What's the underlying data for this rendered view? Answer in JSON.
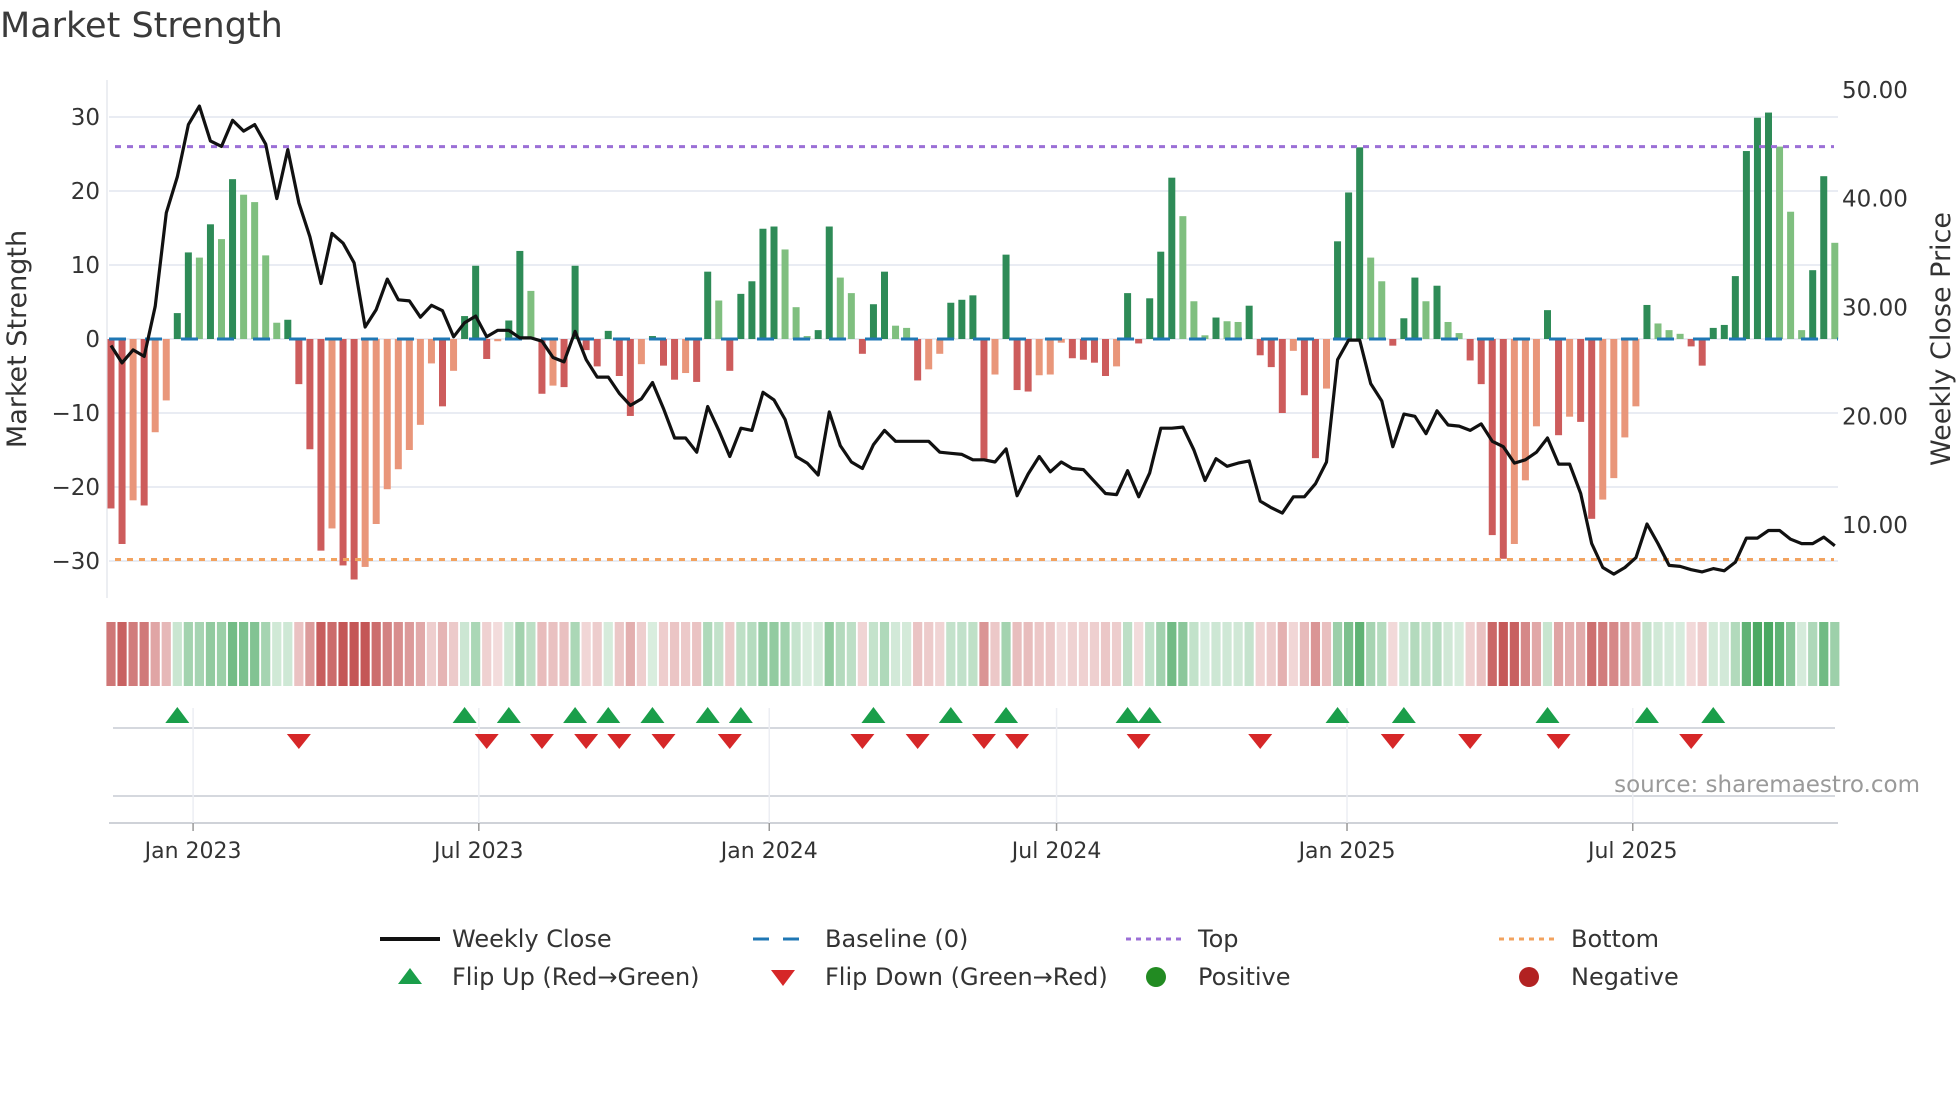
{
  "title": "Market Strength",
  "source": "source: sharemaestro.com",
  "colors": {
    "bar_pos_strong": "#2e8b57",
    "bar_pos_weak": "#7fbf7f",
    "bar_neg_strong": "#cd5c5c",
    "bar_neg_weak": "#e9967a",
    "baseline": "#1f77b4",
    "top": "#9b6fd6",
    "bottom": "#f2a25e",
    "flip_up": "#1a9e4a",
    "flip_down": "#d62728",
    "positive": "#228b22",
    "negative": "#b22222",
    "heat_pos": "#4aa862",
    "heat_neg": "#c45656",
    "grid": "#e9ecf3",
    "price": "#111111"
  },
  "legend": {
    "weekly_close": "Weekly Close",
    "baseline": "Baseline (0)",
    "top": "Top",
    "bottom": "Bottom",
    "flip_up": "Flip Up (Red→Green)",
    "flip_down": "Flip Down (Green→Red)",
    "positive": "Positive",
    "negative": "Negative"
  },
  "chart_data": {
    "type": "bar",
    "title": "Market Strength",
    "ylabel": "Market Strength",
    "y2label": "Weekly Close Price",
    "ylim": [
      -35,
      35
    ],
    "y2lim": [
      3.3,
      50.9
    ],
    "yticks": [
      -30,
      -20,
      -10,
      0,
      10,
      20,
      30
    ],
    "ytick_labels": [
      "−30",
      "−20",
      "−10",
      "0",
      "10",
      "20",
      "30"
    ],
    "y2ticks": [
      10,
      20,
      30,
      40,
      50
    ],
    "y2tick_labels": [
      "10.00",
      "20.00",
      "30.00",
      "40.00",
      "50.00"
    ],
    "x_start": "2022-11-10",
    "x_step_days": 7,
    "xticks": [
      "2023-01-01",
      "2023-07-01",
      "2024-01-01",
      "2024-07-01",
      "2025-01-01",
      "2025-07-01"
    ],
    "xtick_labels": [
      "Jan 2023",
      "Jul 2023",
      "Jan 2024",
      "Jul 2024",
      "Jan 2025",
      "Jul 2025"
    ],
    "top_level": 26.0,
    "bottom_level": -29.8,
    "baseline": 0,
    "strength": [
      -22.9,
      -27.7,
      -21.8,
      -22.5,
      -12.6,
      -8.3,
      3.5,
      11.7,
      11,
      15.5,
      13.5,
      21.6,
      19.5,
      18.5,
      11.3,
      2.2,
      2.6,
      -6.1,
      -14.9,
      -28.6,
      -25.6,
      -30.6,
      -32.5,
      -30.8,
      -25,
      -20.3,
      -17.6,
      -15,
      -11.6,
      -3.3,
      -9.1,
      -4.3,
      3.1,
      9.9,
      -2.7,
      -0.3,
      2.5,
      11.9,
      6.5,
      -7.4,
      -6.3,
      -6.5,
      9.9,
      -1.5,
      -3.7,
      1.1,
      -5,
      -10.4,
      -3.4,
      0.4,
      -3.6,
      -5.5,
      -4.6,
      -5.8,
      9.1,
      5.2,
      -4.3,
      6.1,
      7.8,
      14.9,
      15.2,
      12.1,
      4.3,
      0.4,
      1.2,
      15.2,
      8.3,
      6.2,
      -2,
      4.7,
      9.1,
      1.8,
      1.5,
      -5.6,
      -4.1,
      -2,
      4.9,
      5.3,
      5.9,
      -16.2,
      -4.8,
      11.4,
      -6.9,
      -7.1,
      -4.9,
      -4.8,
      -0.5,
      -2.6,
      -2.8,
      -3.2,
      -5,
      -3.7,
      6.2,
      -0.6,
      5.5,
      11.8,
      21.8,
      16.6,
      5.1,
      0.5,
      2.9,
      2.4,
      2.3,
      4.5,
      -2.2,
      -3.8,
      -10,
      -1.6,
      -7.6,
      -16.1,
      -6.7,
      13.2,
      19.8,
      25.9,
      11,
      7.8,
      -0.9,
      2.8,
      8.3,
      5.1,
      7.2,
      2.3,
      0.8,
      -2.9,
      -6.1,
      -26.5,
      -29.7,
      -27.7,
      -19.1,
      -11.8,
      3.9,
      -13,
      -10.5,
      -11.2,
      -24.3,
      -21.7,
      -18.8,
      -13.3,
      -9.1,
      4.6,
      2.1,
      1.2,
      0.7,
      -1,
      -3.6,
      1.5,
      1.9,
      8.5,
      25.4,
      29.9,
      30.6,
      26,
      17.2,
      1.2,
      9.3,
      22,
      13
    ],
    "weekly_close": [
      26.5,
      24.9,
      26.1,
      25.5,
      30.1,
      38.7,
      42,
      46.8,
      48.5,
      45.3,
      44.8,
      47.2,
      46.2,
      46.8,
      45,
      40,
      44.5,
      39.6,
      36.5,
      32.2,
      36.8,
      35.9,
      34.1,
      28.2,
      29.8,
      32.6,
      30.7,
      30.6,
      29.1,
      30.2,
      29.7,
      27.3,
      28.6,
      29.2,
      27.3,
      27.9,
      27.9,
      27.2,
      27.2,
      26.9,
      25.4,
      25,
      27.8,
      25.2,
      23.6,
      23.6,
      22.1,
      21,
      21.6,
      23.1,
      20.7,
      18,
      18,
      16.7,
      20.9,
      18.7,
      16.3,
      18.9,
      18.7,
      22.2,
      21.5,
      19.7,
      16.3,
      15.7,
      14.6,
      20.4,
      17.3,
      15.8,
      15.2,
      17.4,
      18.7,
      17.7,
      17.7,
      17.7,
      17.7,
      16.7,
      16.6,
      16.5,
      16,
      16,
      15.8,
      17,
      12.7,
      14.7,
      16.3,
      14.9,
      15.8,
      15.2,
      15.1,
      14,
      12.9,
      12.8,
      15,
      12.6,
      14.8,
      18.9,
      18.9,
      19,
      16.9,
      14.1,
      16.1,
      15.4,
      15.7,
      15.9,
      12.2,
      11.6,
      11.1,
      12.6,
      12.6,
      13.8,
      15.8,
      25.2,
      27,
      27,
      23,
      21.4,
      17.2,
      20.2,
      20,
      18.4,
      20.5,
      19.2,
      19.1,
      18.7,
      19.3,
      17.7,
      17.2,
      15.7,
      16,
      16.7,
      18,
      15.6,
      15.6,
      12.9,
      8.3,
      6.1,
      5.5,
      6.1,
      7,
      10.1,
      8.3,
      6.3,
      6.2,
      5.9,
      5.7,
      6,
      5.8,
      6.6,
      8.8,
      8.8,
      9.5,
      9.5,
      8.7,
      8.3,
      8.3,
      8.9,
      8.1
    ],
    "legend_position": "bottom"
  }
}
